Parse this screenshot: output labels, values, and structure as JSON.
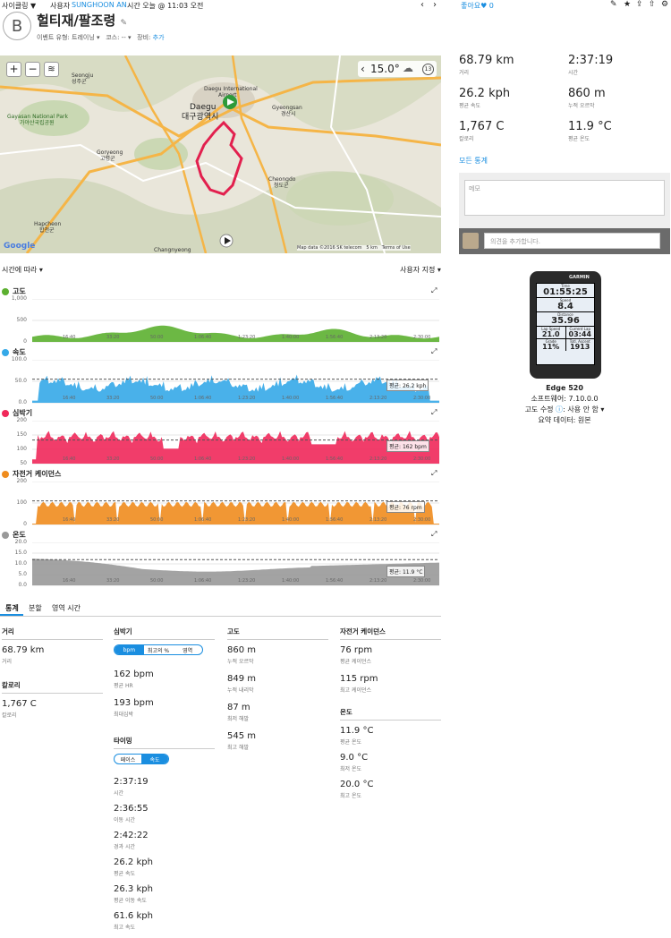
{
  "topbar": {
    "left": "사이클링 ▼",
    "by": "사용자",
    "user": "SUNGHOON AN",
    "time": "시간 오늘 @ 11:03 오전",
    "likes": "좋아요♥ 0"
  },
  "avatar": "B",
  "title": "헐티재/팔조령",
  "meta": {
    "event": "이벤트 유형: 트레이닝 ▾",
    "course": "코스: -- ▾",
    "gear_label": "장비:",
    "gear": "추가"
  },
  "map": {
    "temp": "15.0°",
    "wind": "13",
    "places": [
      "Seongju\n성주군",
      "Daegu International\nAirport",
      "Daegu\n대구광역시",
      "Gyeongsan\n경산시",
      "Gayasan National Park\n가야산국립공원",
      "Goryeong\n고령군",
      "Cheongdo\n청도군",
      "Hapcheon\n합천군",
      "Changnyeong"
    ],
    "google": "Google",
    "copyright": "Map data ©2016 SK telecom",
    "scale": "5 km",
    "terms": "Terms of Use"
  },
  "charts_header": {
    "left": "시간에 따라 ▾",
    "right": "사용자 지정 ▾"
  },
  "charts": [
    {
      "label": "고도",
      "color": "#5cb030",
      "yticks": [
        "1,000",
        "500",
        "0"
      ],
      "avg": ""
    },
    {
      "label": "속도",
      "color": "#35a9e8",
      "yticks": [
        "100.0",
        "50.0",
        "0.0"
      ],
      "avg": "평균: 26.2 kph"
    },
    {
      "label": "심박기",
      "color": "#f0285a",
      "yticks": [
        "200",
        "150",
        "100",
        "50"
      ],
      "avg": "평균: 162 bpm"
    },
    {
      "label": "자전거 케이던스",
      "color": "#ef8c1e",
      "yticks": [
        "200",
        "100",
        "0"
      ],
      "avg": "평균: 76 rpm"
    },
    {
      "label": "온도",
      "color": "#999999",
      "yticks": [
        "20.0",
        "15.0",
        "10.0",
        "5.0",
        "0.0"
      ],
      "avg": "평균: 11.9 °C"
    }
  ],
  "xticks": [
    "16:40",
    "33:20",
    "50:00",
    "1:06:40",
    "1:23:20",
    "1:40:00",
    "1:56:40",
    "2:13:20",
    "2:30:00"
  ],
  "tabs": [
    "통계",
    "분할",
    "영역 시간"
  ],
  "stats": {
    "distance": {
      "title": "거리",
      "value": "68.79 km",
      "label": "거리"
    },
    "calories": {
      "title": "칼로리",
      "value": "1,767 C",
      "label": "칼로리"
    },
    "hr": {
      "title": "심박기",
      "pill": [
        "bpm",
        "최고의 %",
        "영역"
      ],
      "items": [
        {
          "v": "162 bpm",
          "l": "평균 HR"
        },
        {
          "v": "193 bpm",
          "l": "최대심박"
        }
      ]
    },
    "timing": {
      "title": "타이밍",
      "pill": [
        "페이스",
        "속도"
      ],
      "items": [
        {
          "v": "2:37:19",
          "l": "시간"
        },
        {
          "v": "2:36:55",
          "l": "이동 시간"
        },
        {
          "v": "2:42:22",
          "l": "경과 시간"
        },
        {
          "v": "26.2 kph",
          "l": "평균 속도"
        },
        {
          "v": "26.3 kph",
          "l": "평균 이동 속도"
        },
        {
          "v": "61.6 kph",
          "l": "최고 속도"
        }
      ]
    },
    "elev": {
      "title": "고도",
      "items": [
        {
          "v": "860 m",
          "l": "누적 오르막"
        },
        {
          "v": "849 m",
          "l": "누적 내리막"
        },
        {
          "v": "87 m",
          "l": "최저 해발"
        },
        {
          "v": "545 m",
          "l": "최고 해발"
        }
      ]
    },
    "cad": {
      "title": "자전거 케이던스",
      "items": [
        {
          "v": "76 rpm",
          "l": "평균 케이던스"
        },
        {
          "v": "115 rpm",
          "l": "최고 케이던스"
        }
      ]
    },
    "temp": {
      "title": "온도",
      "items": [
        {
          "v": "11.9 °C",
          "l": "평균 온도"
        },
        {
          "v": "9.0 °C",
          "l": "최저 온도"
        },
        {
          "v": "20.0 °C",
          "l": "최고 온도"
        }
      ]
    }
  },
  "right_stats": [
    {
      "v": "68.79 km",
      "l": "거리"
    },
    {
      "v": "2:37:19",
      "l": "시간"
    },
    {
      "v": "26.2 kph",
      "l": "평균 속도"
    },
    {
      "v": "860 m",
      "l": "누적 오르막"
    },
    {
      "v": "1,767 C",
      "l": "칼로리"
    },
    {
      "v": "11.9 °C",
      "l": "평균 온도"
    }
  ],
  "all_stats": "모든 통계",
  "memo_placeholder": "메모",
  "comment_placeholder": "의견을 추가합니다.",
  "device": {
    "brand": "GARMIN",
    "screen": {
      "time_l": "Time",
      "time_v": "01:55:25",
      "speed_l": "Speed",
      "speed_v": "8.4",
      "dist_l": "Distance",
      "dist_v": "35.96",
      "lap_l": "Lap Speed",
      "lap_v": "21.0",
      "cur_l": "Current Lap",
      "cur_v": "03:44",
      "grade_l": "Grade",
      "grade_v": "11%",
      "asc_l": "Totl. Ascent",
      "asc_v": "1913"
    },
    "name": "Edge 520",
    "software": "소프트웨어: 7.10.0.0",
    "elev_fix": "고도 수정",
    "elev_fix_val": ": 사용 안 함 ▾",
    "summary": "요약 데이터: 원본"
  }
}
